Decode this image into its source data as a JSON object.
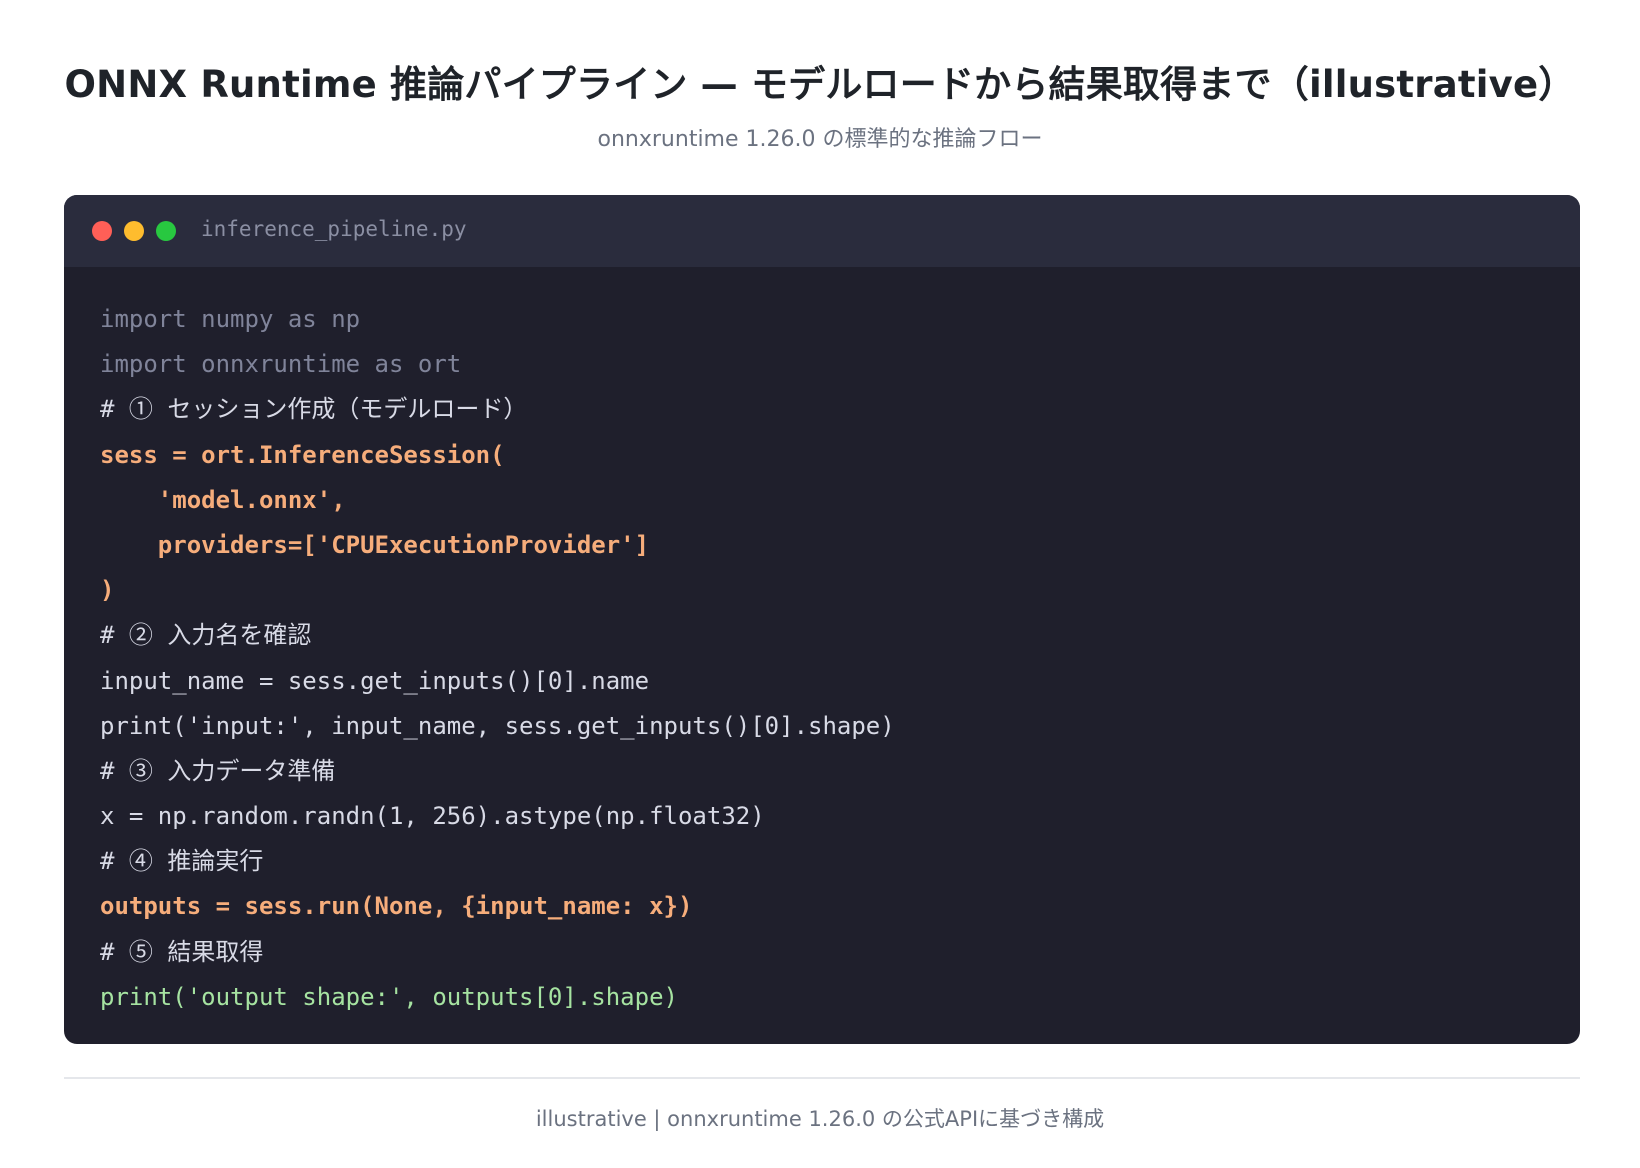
{
  "header": {
    "title": "ONNX Runtime 推論パイプライン — モデルロードから結果取得まで（illustrative）",
    "subtitle": "onnxruntime 1.26.0 の標準的な推論フロー"
  },
  "editor": {
    "filename": "inference_pipeline.py",
    "lines": [
      {
        "text": "import numpy as np",
        "kind": "import"
      },
      {
        "text": "import onnxruntime as ort",
        "kind": "import"
      },
      {
        "text": "# ① セッション作成（モデルロード）",
        "kind": "comment"
      },
      {
        "text": "sess = ort.InferenceSession(",
        "kind": "highlight"
      },
      {
        "text": "    'model.onnx',",
        "kind": "highlight"
      },
      {
        "text": "    providers=['CPUExecutionProvider']",
        "kind": "highlight"
      },
      {
        "text": ")",
        "kind": "highlight"
      },
      {
        "text": "# ② 入力名を確認",
        "kind": "comment"
      },
      {
        "text": "input_name = sess.get_inputs()[0].name",
        "kind": "plain"
      },
      {
        "text": "print('input:', input_name, sess.get_inputs()[0].shape)",
        "kind": "plain"
      },
      {
        "text": "# ③ 入力データ準備",
        "kind": "comment"
      },
      {
        "text": "x = np.random.randn(1, 256).astype(np.float32)",
        "kind": "plain"
      },
      {
        "text": "# ④ 推論実行",
        "kind": "comment"
      },
      {
        "text": "outputs = sess.run(None, {input_name: x})",
        "kind": "highlight"
      },
      {
        "text": "# ⑤ 結果取得",
        "kind": "comment"
      },
      {
        "text": "print('output shape:', outputs[0].shape)",
        "kind": "output"
      }
    ],
    "window_controls": {
      "close_color": "#ff5f57",
      "minimize_color": "#febc2e",
      "maximize_color": "#28c840"
    }
  },
  "footer": {
    "note": "illustrative | onnxruntime 1.26.0 の公式APIに基づき構成"
  }
}
